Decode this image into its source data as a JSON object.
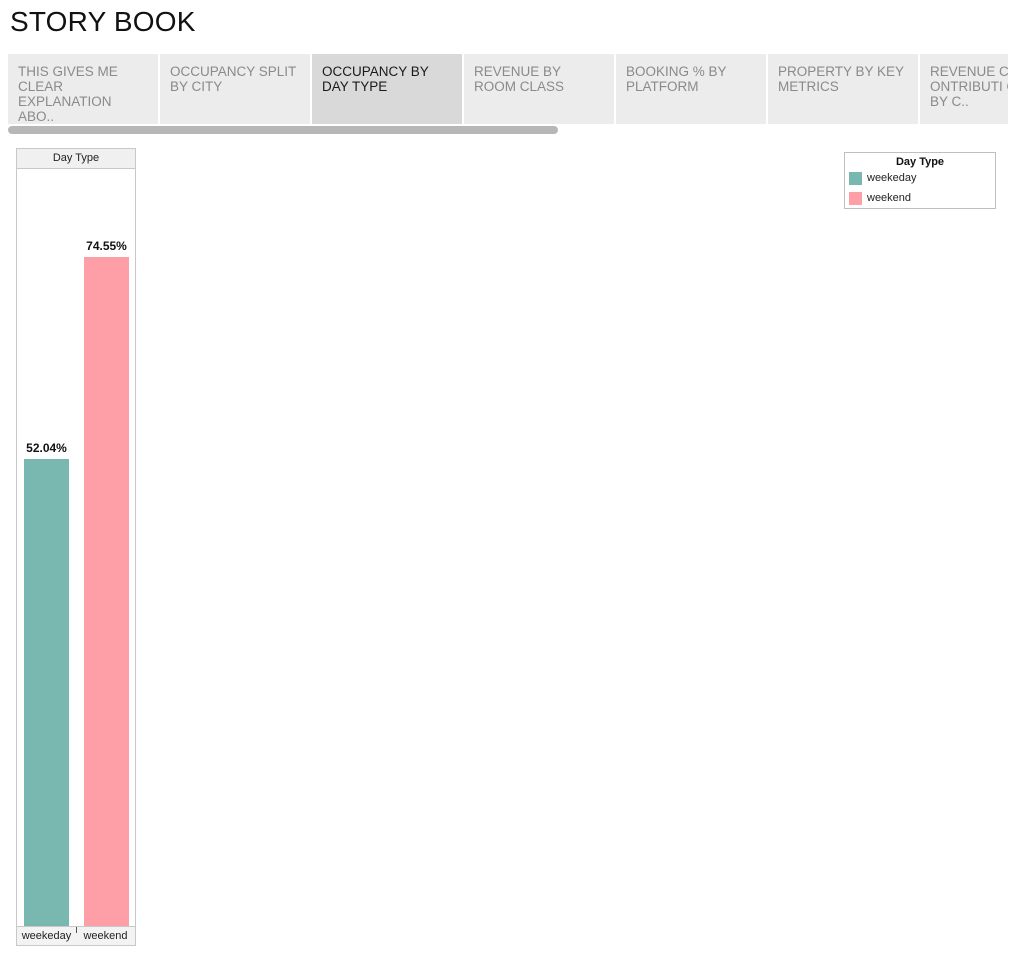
{
  "story": {
    "title": "STORY BOOK"
  },
  "tabs": [
    {
      "label": "THIS  GIVES ME CLEAR EXPLANATION ABO..",
      "active": false
    },
    {
      "label": "OCCUPANCY  SPLIT BY CITY",
      "active": false
    },
    {
      "label": "OCCUPANCY BY DAY TYPE",
      "active": true
    },
    {
      "label": "REVENUE BY ROOM CLASS",
      "active": false
    },
    {
      "label": "BOOKING % BY PLATFORM",
      "active": false
    },
    {
      "label": "PROPERTY BY KEY METRICS",
      "active": false
    },
    {
      "label": "REVENUE C ONTRIBUTI ON % BY C..",
      "active": false
    }
  ],
  "colors": {
    "weekday": "#79b8b1",
    "weekend": "#fe9ea6"
  },
  "legend": {
    "title": "Day Type",
    "items": [
      {
        "label": "weekeday",
        "color": "#79b8b1"
      },
      {
        "label": "weekend",
        "color": "#fe9ea6"
      }
    ]
  },
  "chart_data": {
    "type": "bar",
    "title": "",
    "header": "Day Type",
    "categories": [
      "weekeday",
      "weekend"
    ],
    "values": [
      52.04,
      74.55
    ],
    "value_labels": [
      "52.04%",
      "74.55%"
    ],
    "colors": [
      "#79b8b1",
      "#fe9ea6"
    ],
    "ylim": [
      0,
      84.3
    ],
    "xlabel": "",
    "ylabel": "",
    "grid": false,
    "legend_position": "top-right"
  }
}
